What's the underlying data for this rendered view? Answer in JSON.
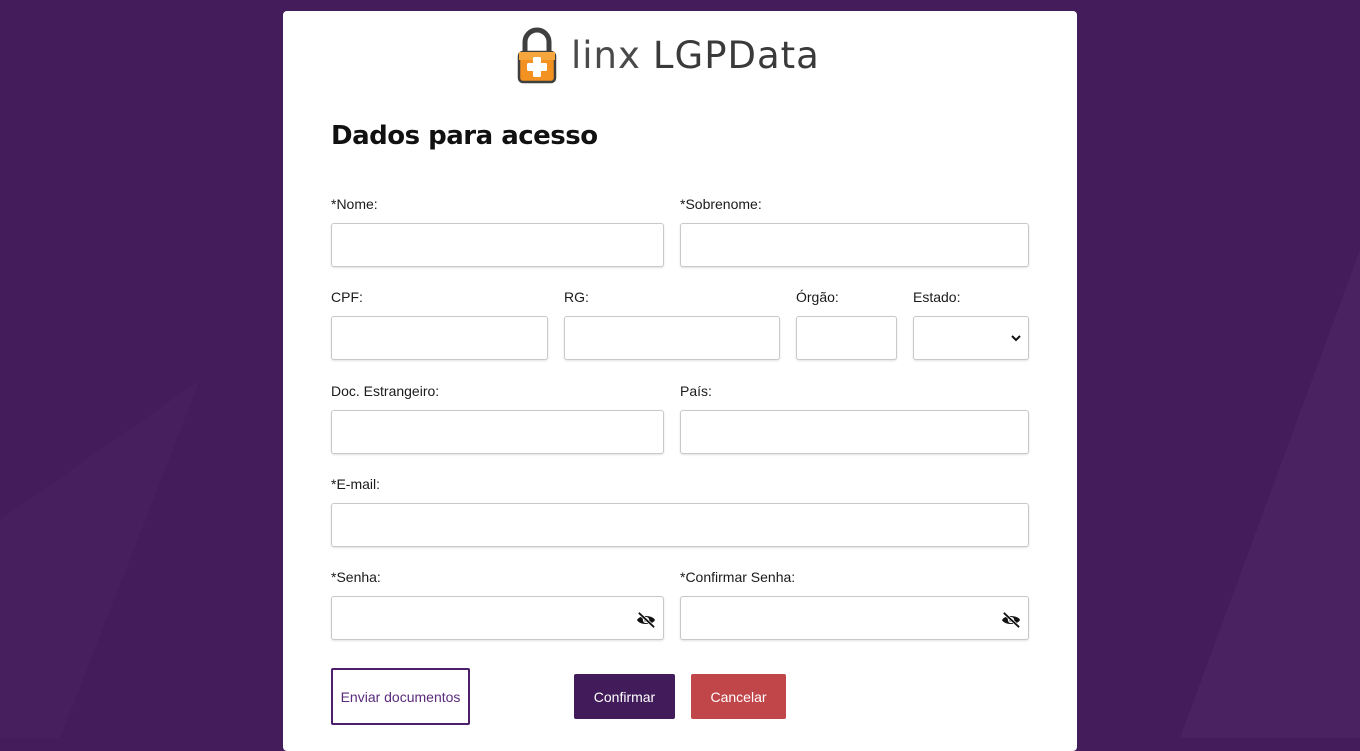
{
  "brand": {
    "logo_light": "linx",
    "logo_bold": "LGPData"
  },
  "form": {
    "title": "Dados para acesso",
    "fields": {
      "nome": {
        "label": "*Nome:",
        "value": ""
      },
      "sobrenome": {
        "label": "*Sobrenome:",
        "value": ""
      },
      "cpf": {
        "label": "CPF:",
        "value": ""
      },
      "rg": {
        "label": "RG:",
        "value": ""
      },
      "orgao": {
        "label": "Órgão:",
        "value": ""
      },
      "estado": {
        "label": "Estado:",
        "value": ""
      },
      "doc_estrangeiro": {
        "label": "Doc. Estrangeiro:",
        "value": ""
      },
      "pais": {
        "label": "País:",
        "value": ""
      },
      "email": {
        "label": "*E-mail:",
        "value": ""
      },
      "senha": {
        "label": "*Senha:",
        "value": ""
      },
      "confirmar_senha": {
        "label": "*Confirmar Senha:",
        "value": ""
      }
    },
    "buttons": {
      "enviar": "Enviar documentos",
      "confirmar": "Confirmar",
      "cancelar": "Cancelar"
    }
  },
  "colors": {
    "background": "#441c5b",
    "primary": "#421c5a",
    "danger": "#c0464a",
    "logo_orange": "#f39221"
  },
  "icons": {
    "logo": "padlock-plus-icon",
    "select": "chevron-down-icon",
    "password_toggle": "eye-slash-icon"
  }
}
